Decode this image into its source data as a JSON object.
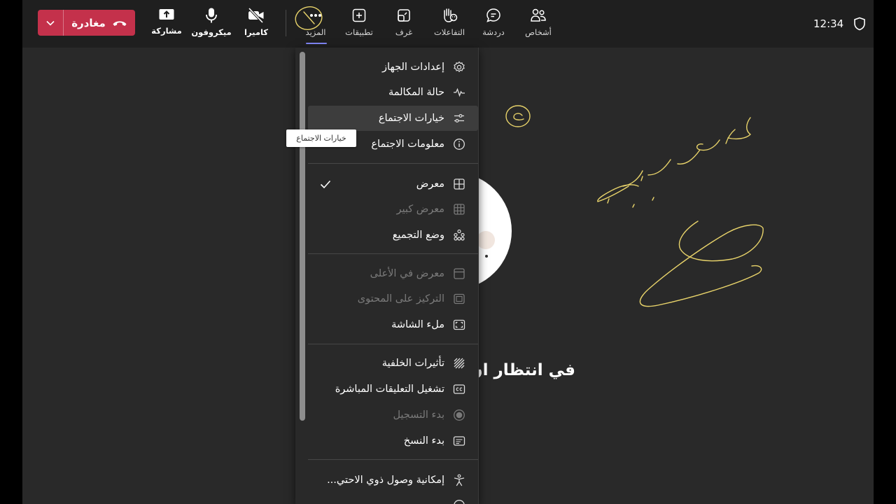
{
  "topbar": {
    "leave_label": "مغادرة",
    "clock": "12:34",
    "buttons": {
      "share": "مشاركة",
      "mic": "ميكروفون",
      "camera": "كاميرا",
      "more": "المزيد",
      "apps": "تطبيقات",
      "rooms": "غرف",
      "reactions": "التفاعلات",
      "chat": "دردشة",
      "people": "أشخاص"
    }
  },
  "stage": {
    "waiting_text": "في انتظار ان"
  },
  "menu": {
    "items": [
      {
        "label": "إعدادات الجهاز",
        "icon": "gear-icon"
      },
      {
        "label": "حالة المكالمة",
        "icon": "pulse-icon"
      },
      {
        "label": "خيارات الاجتماع",
        "icon": "sliders-icon",
        "highlighted": true
      },
      {
        "label": "معلومات الاجتماع",
        "icon": "info-icon"
      },
      {
        "label": "معرض",
        "icon": "grid-icon",
        "checked": true
      },
      {
        "label": "معرض كبير",
        "icon": "large-grid-icon",
        "disabled": true
      },
      {
        "label": "وضع التجميع",
        "icon": "together-mode-icon"
      },
      {
        "label": "معرض في الأعلى",
        "icon": "gallery-top-icon",
        "disabled": true
      },
      {
        "label": "التركيز على المحتوى",
        "icon": "focus-content-icon",
        "disabled": true
      },
      {
        "label": "ملء الشاشة",
        "icon": "fullscreen-icon"
      },
      {
        "label": "تأثيرات الخلفية",
        "icon": "background-effects-icon"
      },
      {
        "label": "تشغيل التعليقات المباشرة",
        "icon": "captions-icon"
      },
      {
        "label": "بدء التسجيل",
        "icon": "record-icon",
        "disabled": true
      },
      {
        "label": "بدء النسخ",
        "icon": "transcript-icon"
      },
      {
        "label": "إمكانية وصول ذوي الاحتي...",
        "icon": "accessibility-icon"
      }
    ]
  },
  "tooltip": "خيارات الاجتماع",
  "colors": {
    "leave": "#c4314b",
    "accent": "#7f85f5",
    "ink": "#e8d36a"
  }
}
